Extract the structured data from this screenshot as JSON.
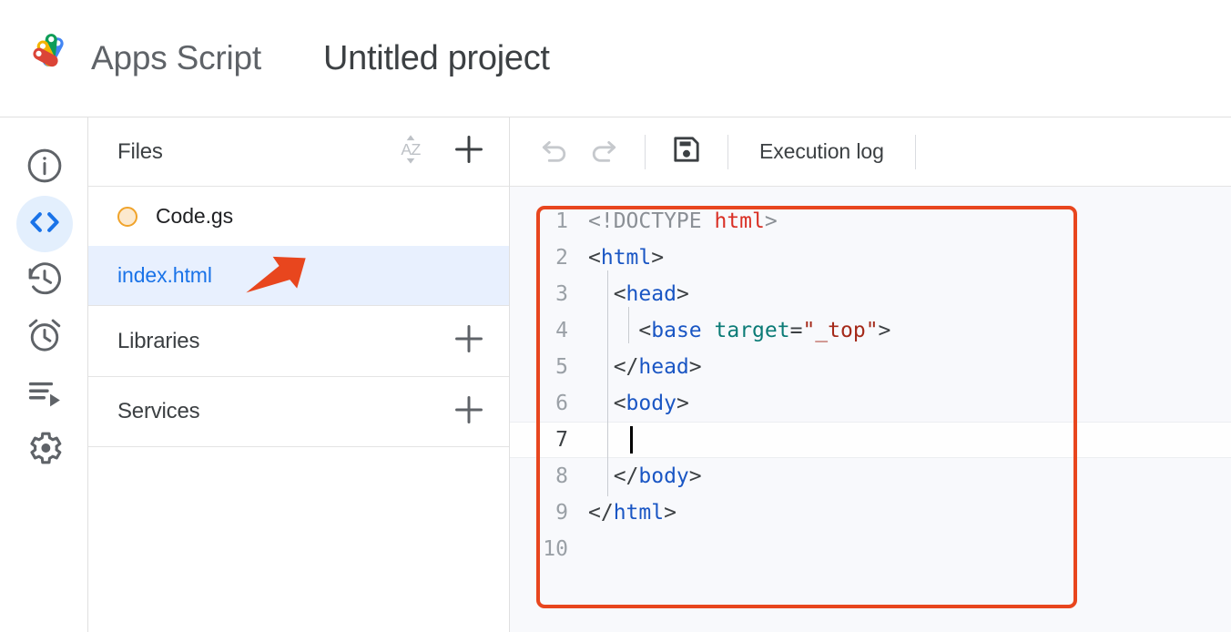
{
  "header": {
    "logo_icon": "apps-script-logo",
    "brand_name": "Apps Script",
    "project_title": "Untitled project"
  },
  "rail": {
    "items": [
      {
        "icon": "info-icon",
        "label": "Overview",
        "active": false
      },
      {
        "icon": "code-icon",
        "label": "Editor",
        "active": true
      },
      {
        "icon": "history-icon",
        "label": "Project history",
        "active": false
      },
      {
        "icon": "alarm-clock-icon",
        "label": "Triggers",
        "active": false
      },
      {
        "icon": "executions-icon",
        "label": "Executions",
        "active": false
      },
      {
        "icon": "gear-icon",
        "label": "Project Settings",
        "active": false
      }
    ]
  },
  "files_panel": {
    "title": "Files",
    "sort_icon": "sort-az-icon",
    "add_icon": "plus-icon",
    "files": [
      {
        "name": "Code.gs",
        "status_icon": "orange-circle-icon",
        "selected": false
      },
      {
        "name": "index.html",
        "status_icon": "none",
        "selected": true
      }
    ],
    "sections": [
      {
        "title": "Libraries",
        "add_icon": "plus-icon"
      },
      {
        "title": "Services",
        "add_icon": "plus-icon"
      }
    ]
  },
  "editor": {
    "toolbar": {
      "undo_icon": "undo-icon",
      "redo_icon": "redo-icon",
      "save_icon": "save-floppy-icon",
      "execution_log_label": "Execution log"
    },
    "active_line": 7,
    "cursor_line": 7,
    "lines": [
      {
        "n": "1",
        "tokens": [
          {
            "t": "<!DOCTYPE ",
            "c": "tok-doctype"
          },
          {
            "t": "html",
            "c": "tok-doctype-name"
          },
          {
            "t": ">",
            "c": "tok-doctype"
          }
        ]
      },
      {
        "n": "2",
        "tokens": [
          {
            "t": "<",
            "c": "tok-punct"
          },
          {
            "t": "html",
            "c": "tok-tag"
          },
          {
            "t": ">",
            "c": "tok-punct"
          }
        ]
      },
      {
        "n": "3",
        "tokens": [
          {
            "t": "  <",
            "c": "tok-punct"
          },
          {
            "t": "head",
            "c": "tok-tag"
          },
          {
            "t": ">",
            "c": "tok-punct"
          }
        ]
      },
      {
        "n": "4",
        "tokens": [
          {
            "t": "    <",
            "c": "tok-punct"
          },
          {
            "t": "base",
            "c": "tok-tag"
          },
          {
            "t": " ",
            "c": "tok-punct"
          },
          {
            "t": "target",
            "c": "tok-attr"
          },
          {
            "t": "=",
            "c": "tok-punct"
          },
          {
            "t": "\"_top\"",
            "c": "tok-str"
          },
          {
            "t": ">",
            "c": "tok-punct"
          }
        ]
      },
      {
        "n": "5",
        "tokens": [
          {
            "t": "  </",
            "c": "tok-punct"
          },
          {
            "t": "head",
            "c": "tok-tag"
          },
          {
            "t": ">",
            "c": "tok-punct"
          }
        ]
      },
      {
        "n": "6",
        "tokens": [
          {
            "t": "  <",
            "c": "tok-punct"
          },
          {
            "t": "body",
            "c": "tok-tag"
          },
          {
            "t": ">",
            "c": "tok-punct"
          }
        ]
      },
      {
        "n": "7",
        "tokens": [
          {
            "t": "    ",
            "c": "tok-punct"
          }
        ]
      },
      {
        "n": "8",
        "tokens": [
          {
            "t": "  </",
            "c": "tok-punct"
          },
          {
            "t": "body",
            "c": "tok-tag"
          },
          {
            "t": ">",
            "c": "tok-punct"
          }
        ]
      },
      {
        "n": "9",
        "tokens": [
          {
            "t": "</",
            "c": "tok-punct"
          },
          {
            "t": "html",
            "c": "tok-tag"
          },
          {
            "t": ">",
            "c": "tok-punct"
          }
        ]
      },
      {
        "n": "10",
        "tokens": []
      }
    ]
  },
  "annotations": {
    "highlight_box_color": "#e8461e",
    "arrow_color": "#e8461e",
    "arrow_points_to": "index.html"
  },
  "colors": {
    "accent_blue": "#1a73e8",
    "selected_row_bg": "#e8f0fe",
    "editor_bg": "#f8f9fc",
    "file_status_orange": "#f0a32a",
    "annotation_red": "#e8461e"
  }
}
